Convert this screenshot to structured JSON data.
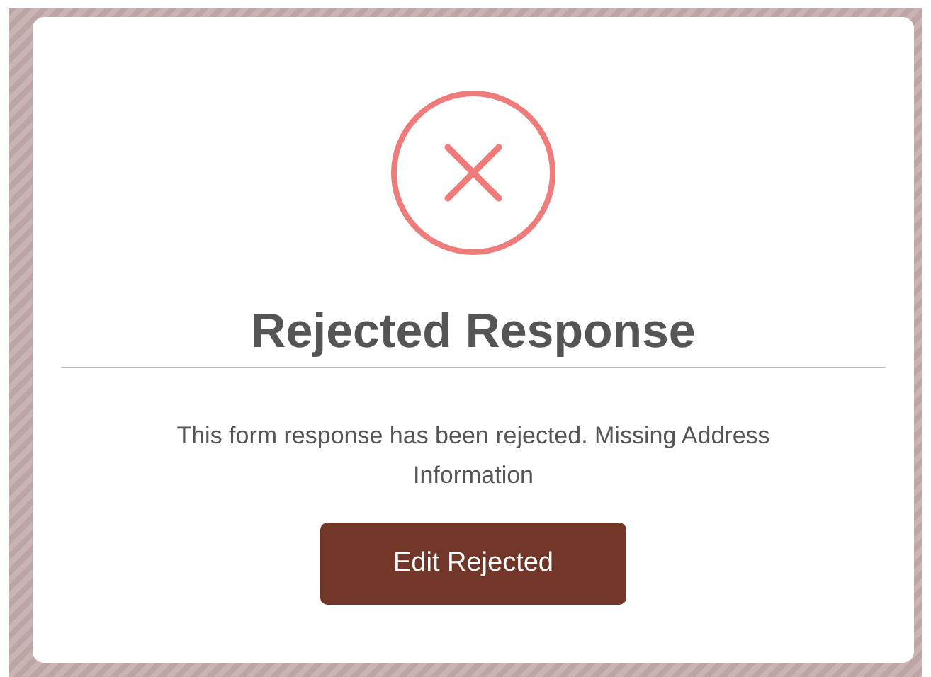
{
  "dialog": {
    "title": "Rejected Response",
    "message": "This form response has been rejected. Missing Address Information",
    "button": "Edit Rejected"
  }
}
